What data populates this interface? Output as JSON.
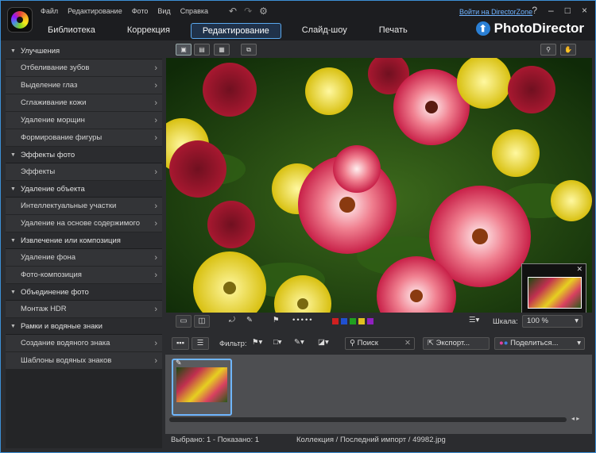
{
  "app": {
    "name": "PhotoDirector"
  },
  "menu": [
    "Файл",
    "Редактирование",
    "Фото",
    "Вид",
    "Справка"
  ],
  "directorzone_link": "Войти на DirectorZone",
  "window_controls": [
    "?",
    "–",
    "□",
    "×"
  ],
  "tabs": [
    {
      "label": "Библиотека"
    },
    {
      "label": "Коррекция"
    },
    {
      "label": "Редактирование",
      "active": true
    },
    {
      "label": "Слайд-шоу"
    },
    {
      "label": "Печать"
    }
  ],
  "sidebar": {
    "sections": [
      {
        "title": "Улучшения",
        "items": [
          "Отбеливание зубов",
          "Выделение глаз",
          "Сглаживание кожи",
          "Удаление морщин",
          "Формирование фигуры"
        ]
      },
      {
        "title": "Эффекты фото",
        "items": [
          "Эффекты"
        ]
      },
      {
        "title": "Удаление объекта",
        "items": [
          "Интеллектуальные участки",
          "Удаление на основе содержимого"
        ]
      },
      {
        "title": "Извлечение или композиция",
        "items": [
          "Удаление фона",
          "Фото-композиция"
        ]
      },
      {
        "title": "Объединение фото",
        "items": [
          "Монтаж HDR"
        ]
      },
      {
        "title": "Рамки и водяные знаки",
        "items": [
          "Создание водяного знака",
          "Шаблоны водяных знаков"
        ]
      }
    ]
  },
  "toolbar": {
    "zoom_label": "Шкала:",
    "zoom_value": "100 %",
    "color_labels": [
      "#d02020",
      "#2050d0",
      "#20a020",
      "#e0c020",
      "#9020c0"
    ]
  },
  "filter": {
    "label": "Фильтр:",
    "search_placeholder": "Поиск",
    "export_label": "Экспорт...",
    "share_label": "Поделиться..."
  },
  "status": {
    "left": "Выбрано: 1 - Показано: 1",
    "center": "Коллекция / Последний импорт / 49982.jpg"
  },
  "colors": {
    "accent": "#5aa8ee"
  }
}
